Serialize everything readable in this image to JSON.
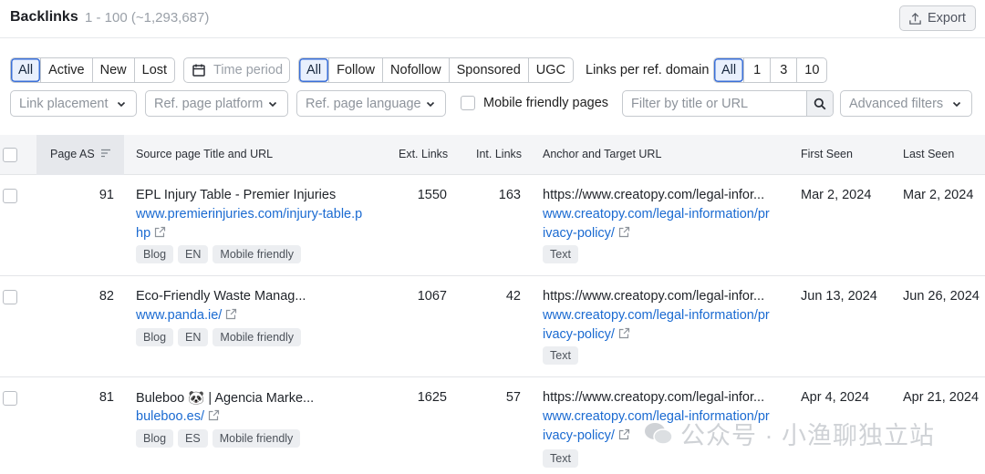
{
  "header": {
    "title": "Backlinks",
    "range": "1 - 100 (~1,293,687)",
    "export_label": "Export"
  },
  "status_filter": {
    "options": [
      "All",
      "Active",
      "New",
      "Lost"
    ],
    "selected": "All"
  },
  "time_period": {
    "label": "Time period"
  },
  "link_type_filter": {
    "options": [
      "All",
      "Follow",
      "Nofollow",
      "Sponsored",
      "UGC"
    ],
    "selected": "All"
  },
  "links_per_domain": {
    "label": "Links per ref. domain",
    "options": [
      "All",
      "1",
      "3",
      "10"
    ],
    "selected": "All"
  },
  "filters": {
    "link_placement": "Link placement",
    "ref_page_platform": "Ref. page platform",
    "ref_page_language": "Ref. page language",
    "mobile_friendly_label": "Mobile friendly pages",
    "search_placeholder": "Filter by title or URL",
    "advanced_filters": "Advanced filters"
  },
  "table": {
    "columns": {
      "page_as": "Page AS",
      "source": "Source page Title and URL",
      "ext_links": "Ext. Links",
      "int_links": "Int. Links",
      "anchor": "Anchor and Target URL",
      "first_seen": "First Seen",
      "last_seen": "Last Seen"
    },
    "rows": [
      {
        "page_as": "91",
        "title": "EPL Injury Table - Premier Injuries",
        "url_line1": "www.premierinjuries.com/injury-table.p",
        "url_line2": "hp",
        "tags": [
          "Blog",
          "EN",
          "Mobile friendly"
        ],
        "ext_links": "1550",
        "int_links": "163",
        "anchor": "https://www.creatopy.com/legal-infor...",
        "target_line1": "www.creatopy.com/legal-information/pr",
        "target_line2": "ivacy-policy/",
        "anchor_tag": "Text",
        "first_seen": "Mar 2, 2024",
        "last_seen": "Mar 2, 2024"
      },
      {
        "page_as": "82",
        "title": "Eco-Friendly Waste Manag...",
        "url_line1": "www.panda.ie/",
        "url_line2": "",
        "tags": [
          "Blog",
          "EN",
          "Mobile friendly"
        ],
        "ext_links": "1067",
        "int_links": "42",
        "anchor": "https://www.creatopy.com/legal-infor...",
        "target_line1": "www.creatopy.com/legal-information/pr",
        "target_line2": "ivacy-policy/",
        "anchor_tag": "Text",
        "first_seen": "Jun 13, 2024",
        "last_seen": "Jun 26, 2024"
      },
      {
        "page_as": "81",
        "title": "Buleboo 🐼 | Agencia Marke...",
        "url_line1": "buleboo.es/",
        "url_line2": "",
        "tags": [
          "Blog",
          "ES",
          "Mobile friendly"
        ],
        "ext_links": "1625",
        "int_links": "57",
        "anchor": "https://www.creatopy.com/legal-infor...",
        "target_line1": "www.creatopy.com/legal-information/pr",
        "target_line2": "ivacy-policy/",
        "anchor_tag": "Text",
        "first_seen": "Apr 4, 2024",
        "last_seen": "Apr 21, 2024"
      }
    ]
  },
  "watermark": {
    "text": "公众号 · 小渔聊独立站"
  },
  "colors": {
    "accent": "#3a6fd8",
    "link": "#1a6ad1",
    "active_bg": "#e9f0fd"
  }
}
